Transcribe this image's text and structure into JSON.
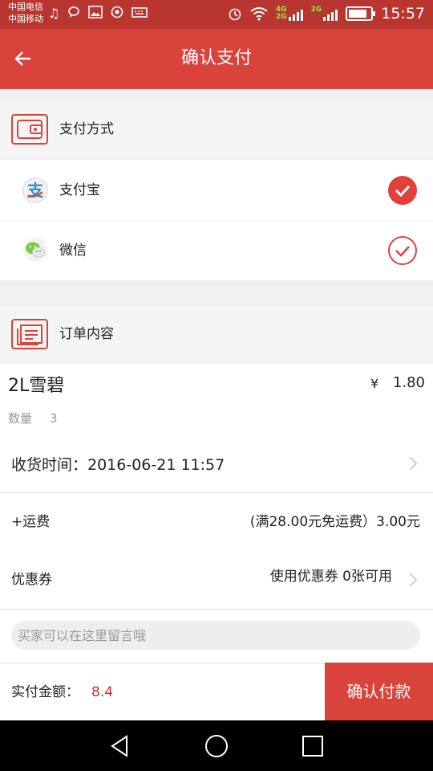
{
  "status_bar": {
    "carrier_1": "中国电信",
    "carrier_2": "中国移动",
    "net_4g": "4G",
    "net_2g_a": "2G",
    "net_2g_b": "2G",
    "time": "15:57",
    "battery_level": 0.85
  },
  "header": {
    "title": "确认支付",
    "back_icon": "arrow-left-icon"
  },
  "payment_section": {
    "title": "支付方式",
    "icon": "wallet-icon",
    "options": [
      {
        "label": "支付宝",
        "icon": "alipay-logo-icon",
        "selected": true
      },
      {
        "label": "微信",
        "icon": "wechat-logo-icon",
        "selected": false
      }
    ]
  },
  "order_section": {
    "title": "订单内容",
    "icon": "order-list-icon",
    "product": {
      "name": "2L雪碧",
      "currency": "¥",
      "price": "1.80",
      "qty_label": "数量",
      "qty": "3"
    },
    "delivery_time": "收货时间：2016-06-21 11:57",
    "shipping_label": "+运费",
    "shipping_value": "(满28.00元免运费）3.00元",
    "coupon_label": "优惠券",
    "coupon_value": "使用优惠券 0张可用",
    "message_placeholder": "买家可以在这里留言哦"
  },
  "bottom_bar": {
    "total_label": "实付金额：",
    "total_value": "8.4",
    "confirm_label": "确认付款"
  },
  "colors": {
    "brand_red": "#d9433b",
    "status_red": "#b8362f",
    "price_red": "#c9302c"
  }
}
